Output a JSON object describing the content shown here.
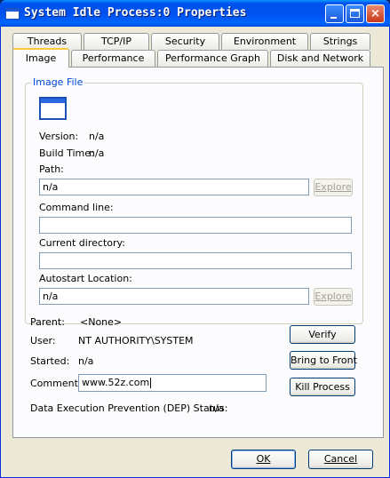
{
  "window": {
    "title": "System Idle Process:0 Properties",
    "buttons": {
      "minimize": "minimize",
      "maximize": "maximize",
      "close": "×"
    }
  },
  "tabs": {
    "row1": [
      "Threads",
      "TCP/IP",
      "Security",
      "Environment",
      "Strings"
    ],
    "row2": [
      "Image",
      "Performance",
      "Performance Graph",
      "Disk and Network"
    ],
    "active": "Image"
  },
  "image_file": {
    "group_title": "Image File",
    "version_label": "Version:",
    "version_value": "n/a",
    "build_time_label": "Build Time:",
    "build_time_value": "n/a",
    "path_label": "Path:",
    "path_value": "n/a",
    "explore_label": "Explore",
    "command_line_label": "Command line:",
    "command_line_value": "",
    "current_directory_label": "Current directory:",
    "current_directory_value": "",
    "autostart_label": "Autostart Location:",
    "autostart_value": "n/a"
  },
  "details": {
    "parent_label": "Parent:",
    "parent_value": "<None>",
    "user_label": "User:",
    "user_value": "NT AUTHORITY\\SYSTEM",
    "started_label": "Started:",
    "started_value": "n/a",
    "comment_label": "Comment:",
    "comment_value": "www.52z.com",
    "dep_label": "Data Execution Prevention (DEP) Status:",
    "dep_value": "n/a"
  },
  "actions": {
    "verify": "Verify",
    "bring_to_front": "Bring to Front",
    "kill_process": "Kill Process"
  },
  "footer": {
    "ok": "OK",
    "cancel": "Cancel"
  },
  "icons": {
    "title": "window-icon",
    "image": "application-window-icon"
  }
}
